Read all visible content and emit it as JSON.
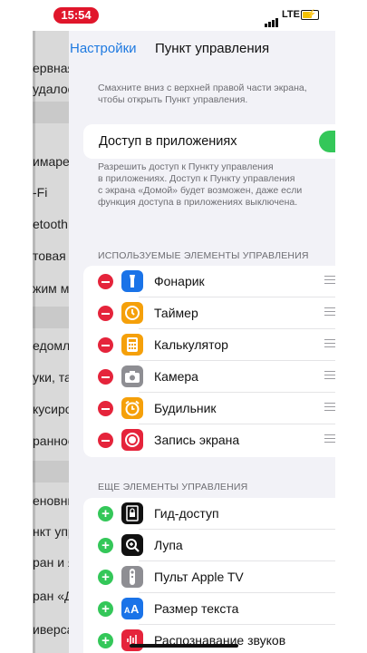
{
  "status": {
    "time": "15:54",
    "network": "LTE"
  },
  "nav": {
    "back_label": "Настройки",
    "title": "Пункт управления"
  },
  "left_panel_items": [
    "ервная",
    "удалос",
    "имарежи",
    "-Fi",
    "etooth",
    "товая с",
    "жим мо",
    "едомле",
    "уки, та",
    "кусиро",
    "ранное",
    "еновны",
    "нкт упр",
    "ран и я",
    "ран «Д",
    "иверса"
  ],
  "hint_top": [
    "Смахните вниз с верхней правой части экрана,",
    "чтобы открыть Пункт управления."
  ],
  "access": {
    "label": "Доступ в приложениях",
    "enabled": true
  },
  "access_hint": [
    "Разрешить доступ к Пункту управления",
    "в приложениях. Доступ к Пункту управления",
    "с экрана «Домой» будет возможен, даже если",
    "функция доступа в приложениях выключена."
  ],
  "included_header": "ИСПОЛЬЗУЕМЫЕ ЭЛЕМЕНТЫ УПРАВЛЕНИЯ",
  "included": [
    {
      "label": "Фонарик",
      "icon": "flashlight-icon",
      "color": "#1a73e8"
    },
    {
      "label": "Таймер",
      "icon": "timer-icon",
      "color": "#f5a00a"
    },
    {
      "label": "Калькулятор",
      "icon": "calculator-icon",
      "color": "#f5a00a"
    },
    {
      "label": "Камера",
      "icon": "camera-icon",
      "color": "#8e8e93"
    },
    {
      "label": "Будильник",
      "icon": "alarm-icon",
      "color": "#f5a00a"
    },
    {
      "label": "Запись экрана",
      "icon": "screen-record-icon",
      "color": "#e5243b"
    }
  ],
  "more_header": "ЕЩЕ ЭЛЕМЕНТЫ УПРАВЛЕНИЯ",
  "more": [
    {
      "label": "Гид-доступ",
      "icon": "guided-access-icon",
      "color": "#111111"
    },
    {
      "label": "Лупа",
      "icon": "magnifier-icon",
      "color": "#111111"
    },
    {
      "label": "Пульт Apple TV",
      "icon": "apple-tv-remote-icon",
      "color": "#8e8e93"
    },
    {
      "label": "Размер текста",
      "icon": "text-size-icon",
      "color": "#1a73e8"
    },
    {
      "label": "Распознавание звуков",
      "icon": "sound-recognition-icon",
      "color": "#e5243b"
    }
  ]
}
